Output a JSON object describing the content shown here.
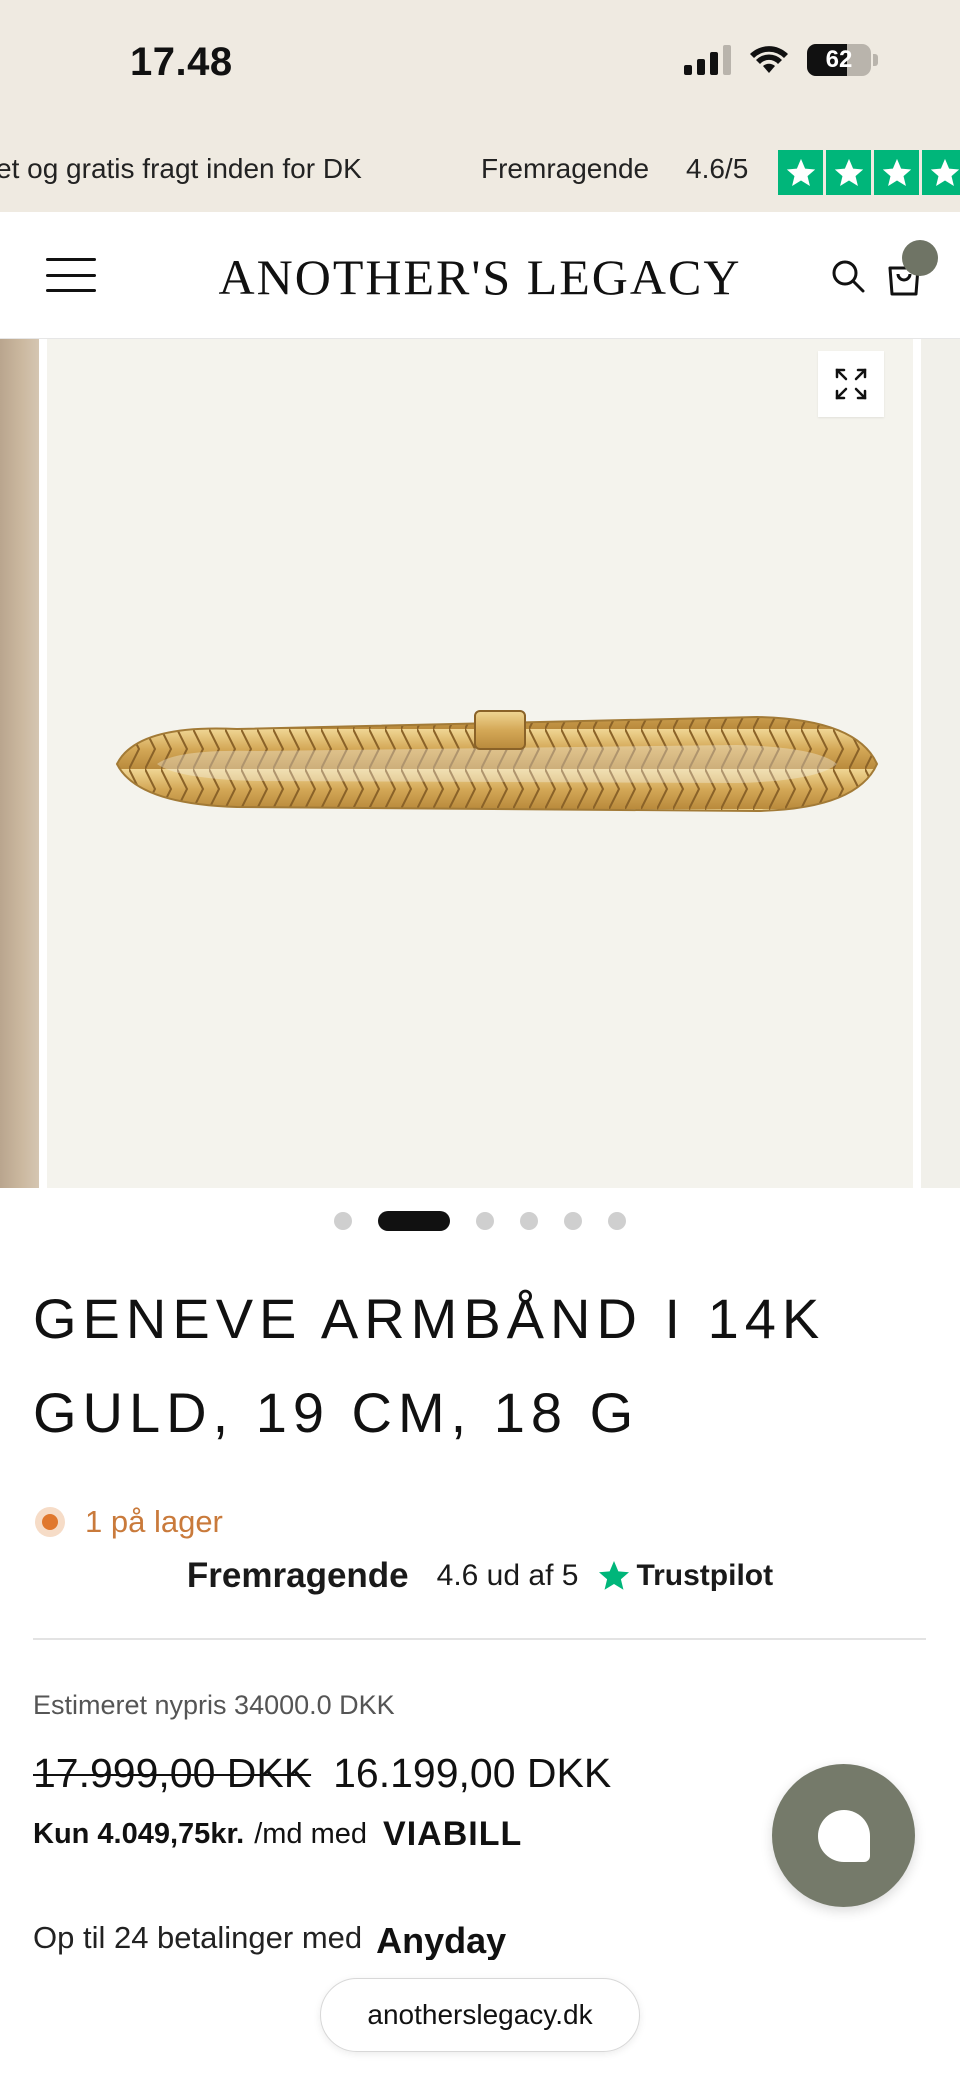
{
  "status_bar": {
    "time": "17.48",
    "battery": "62",
    "battery_level": 0.62
  },
  "announcement": {
    "text": "et og gratis fragt inden for DK",
    "rating_label": "Fremragende",
    "rating_score": "4.6/5"
  },
  "header": {
    "logo": "ANOTHER'S LEGACY"
  },
  "gallery": {
    "slide_count": 6,
    "active_index": 1
  },
  "product": {
    "title": "GENEVE ARMBÅND I 14K GULD, 19 CM, 18 G",
    "stock": "1 på lager",
    "stock_color": "#e0782e",
    "trustpilot": {
      "label": "Fremragende",
      "score": "4.6 ud af 5",
      "brand": "Trustpilot",
      "color": "#00b67a"
    },
    "estimated_price": "Estimeret nypris 34000.0 DKK",
    "old_price": "17.999,00 DKK",
    "new_price": "16.199,00 DKK",
    "viabill": {
      "amount": "Kun 4.049,75kr.",
      "suffix": "/md med",
      "logo": "VIABILL"
    },
    "anyday": {
      "text": "Op til 24 betalinger med",
      "logo": "Anyday"
    }
  },
  "browser": {
    "url": "anotherslegacy.dk"
  },
  "colors": {
    "announcement_bg": "#efeae1",
    "chat_button": "#757a6a",
    "cart_badge": "#6f7465"
  }
}
